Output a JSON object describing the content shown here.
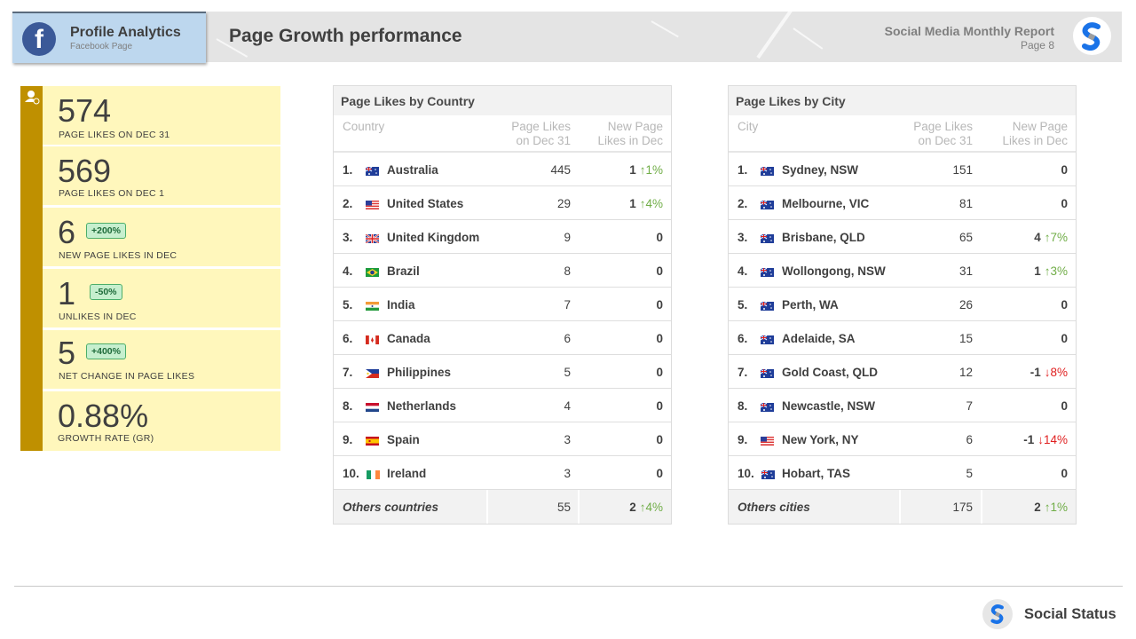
{
  "header": {
    "profile_title": "Profile Analytics",
    "profile_subtitle": "Facebook Page",
    "page_title": "Page Growth  performance",
    "report_title": "Social Media Monthly Report",
    "report_page": "Page 8",
    "icons": {
      "platform": "facebook-icon",
      "logo": "social-status-logo-icon"
    }
  },
  "kpis": [
    {
      "value": "574",
      "label": "PAGE  LIKES  ON DEC  31"
    },
    {
      "value": "569",
      "label": "PAGE  LIKES  ON  DEC  1"
    },
    {
      "value": "6",
      "label": "NEW  PAGE  LIKES  IN  DEC",
      "badge": "+200%"
    },
    {
      "value": "1",
      "label": "UNLIKES  IN  DEC",
      "badge": "-50%"
    },
    {
      "value": "5",
      "label": "NET  CHANGE  IN  PAGE  LIKES",
      "badge": "+400%"
    },
    {
      "value": "0.88%",
      "label": "GROWTH  RATE  (GR)"
    }
  ],
  "country_table": {
    "title": "Page Likes by Country",
    "headers": {
      "name": "Country",
      "likes_l1": "Page Likes",
      "likes_l2": "on Dec 31",
      "new_l1": "New Page",
      "new_l2": "Likes in Dec"
    },
    "rows": [
      {
        "rank": "1.",
        "flag": "au",
        "name": "Australia",
        "likes": "445",
        "new": "1",
        "pct": "1%",
        "dir": "up"
      },
      {
        "rank": "2.",
        "flag": "us",
        "name": "United States",
        "likes": "29",
        "new": "1",
        "pct": "4%",
        "dir": "up"
      },
      {
        "rank": "3.",
        "flag": "gb",
        "name": "United Kingdom",
        "likes": "9",
        "new": "0"
      },
      {
        "rank": "4.",
        "flag": "br",
        "name": "Brazil",
        "likes": "8",
        "new": "0"
      },
      {
        "rank": "5.",
        "flag": "in",
        "name": "India",
        "likes": "7",
        "new": "0"
      },
      {
        "rank": "6.",
        "flag": "ca",
        "name": "Canada",
        "likes": "6",
        "new": "0"
      },
      {
        "rank": "7.",
        "flag": "ph",
        "name": "Philippines",
        "likes": "5",
        "new": "0"
      },
      {
        "rank": "8.",
        "flag": "nl",
        "name": "Netherlands",
        "likes": "4",
        "new": "0"
      },
      {
        "rank": "9.",
        "flag": "es",
        "name": "Spain",
        "likes": "3",
        "new": "0"
      },
      {
        "rank": "10.",
        "flag": "ie",
        "name": "Ireland",
        "likes": "3",
        "new": "0"
      }
    ],
    "others": {
      "name": "Others  countries",
      "likes": "55",
      "new": "2",
      "pct": "4%",
      "dir": "up"
    }
  },
  "city_table": {
    "title": "Page Likes by City",
    "headers": {
      "name": "City",
      "likes_l1": "Page Likes",
      "likes_l2": "on Dec 31",
      "new_l1": "New Page",
      "new_l2": "Likes in Dec"
    },
    "rows": [
      {
        "rank": "1.",
        "flag": "au",
        "name": "Sydney, NSW",
        "likes": "151",
        "new": "0"
      },
      {
        "rank": "2.",
        "flag": "au",
        "name": "Melbourne, VIC",
        "likes": "81",
        "new": "0"
      },
      {
        "rank": "3.",
        "flag": "au",
        "name": "Brisbane, QLD",
        "likes": "65",
        "new": "4",
        "pct": "7%",
        "dir": "up"
      },
      {
        "rank": "4.",
        "flag": "au",
        "name": "Wollongong, NSW",
        "likes": "31",
        "new": "1",
        "pct": "3%",
        "dir": "up"
      },
      {
        "rank": "5.",
        "flag": "au",
        "name": "Perth, WA",
        "likes": "26",
        "new": "0"
      },
      {
        "rank": "6.",
        "flag": "au",
        "name": "Adelaide, SA",
        "likes": "15",
        "new": "0"
      },
      {
        "rank": "7.",
        "flag": "au",
        "name": "Gold Coast, QLD",
        "likes": "12",
        "new": "-1",
        "pct": "8%",
        "dir": "down"
      },
      {
        "rank": "8.",
        "flag": "au",
        "name": "Newcastle, NSW",
        "likes": "7",
        "new": "0"
      },
      {
        "rank": "9.",
        "flag": "us",
        "name": "New York, NY",
        "likes": "6",
        "new": "-1",
        "pct": "14%",
        "dir": "down"
      },
      {
        "rank": "10.",
        "flag": "au",
        "name": "Hobart, TAS",
        "likes": "5",
        "new": "0"
      }
    ],
    "others": {
      "name": "Others  cities",
      "likes": "175",
      "new": "2",
      "pct": "1%",
      "dir": "up"
    }
  },
  "footer": {
    "brand": "Social Status"
  },
  "colors": {
    "accent": "#bf9000",
    "kpi_bg": "#fff7bc",
    "up": "#70ad47",
    "down": "#e02020",
    "facebook": "#3b5998"
  }
}
